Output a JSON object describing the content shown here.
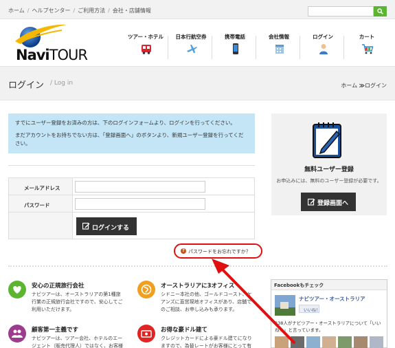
{
  "topbar": {
    "crumbs": [
      "ホーム",
      "ヘルプセンター",
      "ご利用方法",
      "会社・店舗情報"
    ],
    "separator": "/",
    "search_placeholder": ""
  },
  "logo": {
    "text_navi": "Navi",
    "text_tour": "TOUR"
  },
  "nav": [
    {
      "label": "ツアー・ホテル",
      "icon": "bus-icon"
    },
    {
      "label": "日本行航空券",
      "icon": "airplane-icon"
    },
    {
      "label": "携帯電話",
      "icon": "mobile-phone-icon"
    },
    {
      "label": "会社情報",
      "icon": "office-building-icon"
    },
    {
      "label": "ログイン",
      "icon": "user-icon"
    },
    {
      "label": "カート",
      "icon": "cart-icon"
    }
  ],
  "title_bar": {
    "title": "ログイン",
    "subtitle": "/ Log in",
    "breadcrumb_home": "ホーム",
    "breadcrumb_arrow": "≫",
    "breadcrumb_current": "ログイン"
  },
  "info_box": {
    "line1": "すでにユーザー登録をお済みの方は、下のログインフォームより、ログインを行ってください。",
    "line2": "まだアカウントをお持ちでない方は、「登録画面へ」のボタンより、新規ユーザー登録を行ってください。"
  },
  "form": {
    "email_label": "メールアドレス",
    "email_value": "",
    "password_label": "パスワード",
    "password_value": "",
    "login_button": "ログインする"
  },
  "forgot_link": "パスワードをお忘れですか？",
  "sidebar": {
    "title": "無料ユーザー登録",
    "text": "お申込みには、無料のユーザー登録が必要です。",
    "register_button": "登録画面へ"
  },
  "features": [
    {
      "title": "安心の正規旅行会社",
      "text": "ナビツアーは、オーストラリアの第1種旅行業の正規旅行会社ですので、安心してご利用いただけます。",
      "icon": "heart-icon",
      "color": "#5cb531"
    },
    {
      "title": "オーストラリアに3オフィス",
      "text": "シドニー本社の他、ゴールドコースト、ケアンズに直営現地オフィスがあり、店舗でのご相談、お申し込みも承ります。",
      "icon": "globe-icon",
      "color": "#f0a020"
    },
    {
      "title": "顧客第一主義です",
      "text": "ナビツアーは、ツアー会社、ホテルのエージェント（販売代理人）ではなく、お客様のエ",
      "icon": "users-icon",
      "color": "#9b3c8c"
    },
    {
      "title": "お得な豪ドル建て",
      "text": "クレジットカードによる豪ドル建てになりますので、為替レートがお客様にとって有利な",
      "icon": "money-icon",
      "color": "#e02424"
    }
  ],
  "facebook": {
    "header": "Facebookもチェック",
    "page_name": "ナビツアー・オーストラリア",
    "like_label": "いいね！",
    "text": "238人がナビツアー・オーストラリアについて「いいね！」と言っています。"
  },
  "colors": {
    "accent_green": "#5bb531",
    "info_blue": "#c3e5f6",
    "dark_button": "#333333",
    "highlight_red": "#e01010"
  }
}
